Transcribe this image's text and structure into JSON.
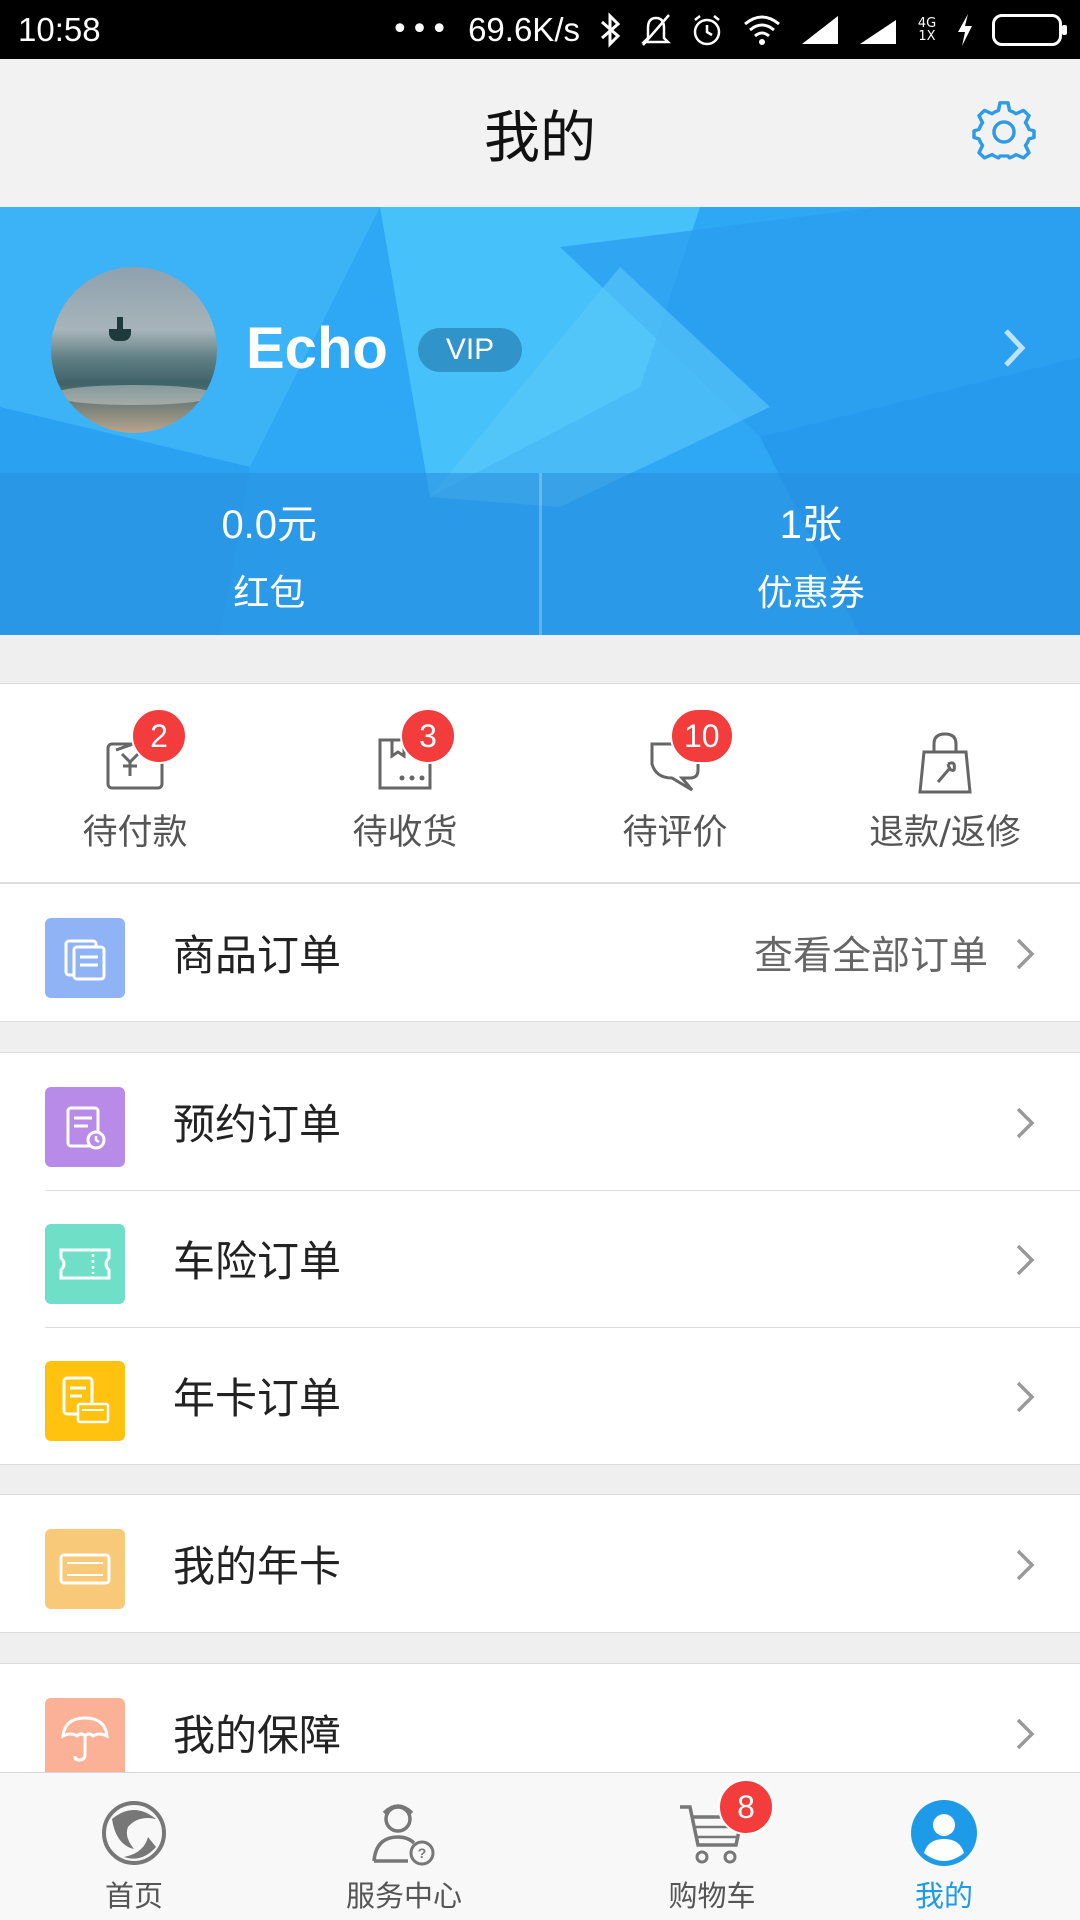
{
  "status_bar": {
    "time": "10:58",
    "dots": "•••",
    "speed": "69.6K/s",
    "network_labels": "4G 1X",
    "icons": [
      "bluetooth-icon",
      "mute-icon",
      "alarm-icon",
      "wifi-icon",
      "signal-icon",
      "signal-icon",
      "charging-icon",
      "battery-icon"
    ]
  },
  "header": {
    "title": "我的",
    "settings_icon": "gear-icon"
  },
  "profile": {
    "username": "Echo",
    "badge": "VIP",
    "wallet": [
      {
        "value": "0.0元",
        "label": "红包"
      },
      {
        "value": "1张",
        "label": "优惠券"
      }
    ]
  },
  "order_status": [
    {
      "label": "待付款",
      "icon": "payment-icon",
      "count": "2"
    },
    {
      "label": "待收货",
      "icon": "delivery-box-icon",
      "count": "3"
    },
    {
      "label": "待评价",
      "icon": "review-icon",
      "count": "10"
    },
    {
      "label": "退款/返修",
      "icon": "refund-bag-icon",
      "count": ""
    }
  ],
  "menu": {
    "product_orders": {
      "label": "商品订单",
      "right": "查看全部订单",
      "icon": "product-order-icon",
      "color": "#8fb3f5"
    },
    "appointment_orders": {
      "label": "预约订单",
      "icon": "appointment-icon",
      "color": "#b88be8"
    },
    "car_insurance_orders": {
      "label": "车险订单",
      "icon": "ticket-icon",
      "color": "#6fe0c7"
    },
    "annual_card_orders": {
      "label": "年卡订单",
      "icon": "year-card-order-icon",
      "color": "#ffc20e"
    },
    "my_annual_card": {
      "label": "我的年卡",
      "icon": "year-card-icon",
      "color": "#f7c978"
    },
    "my_protection": {
      "label": "我的保障",
      "icon": "umbrella-icon",
      "color": "#fbb196"
    }
  },
  "bottom_nav": [
    {
      "label": "首页",
      "icon": "home-logo-icon",
      "active": false
    },
    {
      "label": "服务中心",
      "icon": "service-center-icon",
      "active": false
    },
    {
      "label": "购物车",
      "icon": "cart-icon",
      "active": false,
      "count": "8"
    },
    {
      "label": "我的",
      "icon": "profile-icon",
      "active": true
    }
  ],
  "colors": {
    "accent": "#1e9be8",
    "banner": "#2ea8f5",
    "badge": "#f33c3c"
  }
}
